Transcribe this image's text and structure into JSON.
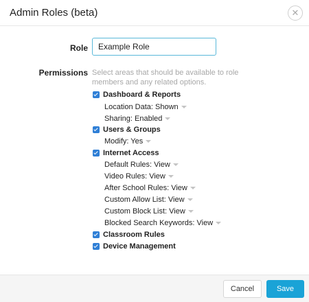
{
  "dialog": {
    "title": "Admin Roles (beta)",
    "close_glyph": "✕"
  },
  "form": {
    "role_label": "Role",
    "role_value": "Example Role",
    "permissions_label": "Permissions",
    "permissions_hint": "Select areas that should be available to role members and any related options."
  },
  "permissions": [
    {
      "label": "Dashboard & Reports",
      "checked": true
    },
    {
      "label": "Location Data: Shown"
    },
    {
      "label": "Sharing: Enabled"
    },
    {
      "label": "Users & Groups",
      "checked": true
    },
    {
      "label": "Modify: Yes"
    },
    {
      "label": "Internet Access",
      "checked": true
    },
    {
      "label": "Default Rules: View"
    },
    {
      "label": "Video Rules: View"
    },
    {
      "label": "After School Rules: View"
    },
    {
      "label": "Custom Allow List: View"
    },
    {
      "label": "Custom Block List: View"
    },
    {
      "label": "Blocked Search Keywords: View"
    },
    {
      "label": "Classroom Rules",
      "checked": true
    },
    {
      "label": "Device Management",
      "checked": true
    }
  ],
  "footer": {
    "cancel_label": "Cancel",
    "save_label": "Save"
  },
  "colors": {
    "accent": "#1aa3d7",
    "checkbox": "#2f7fd6",
    "input_border": "#59b8d9"
  }
}
